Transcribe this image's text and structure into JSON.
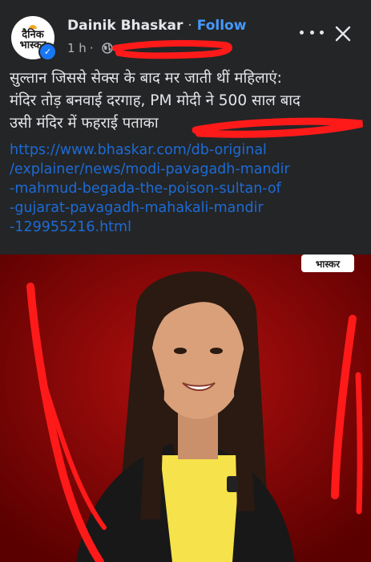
{
  "post": {
    "page_name": "Dainik Bhaskar",
    "separator": "·",
    "follow_label": "Follow",
    "time": "1 h",
    "time_separator": "·",
    "avatar_logo_line1": "दैनिक",
    "avatar_logo_line2": "भास्कर",
    "privacy_icon": "globe-icon",
    "more_icon": "more-horizontal-icon",
    "close_icon": "close-icon",
    "text_lines": [
      "सुल्तान जिससे सेक्स के बाद मर जाती थीं महिलाएं:",
      "मंदिर तोड़ बनवाई दरगाह, PM मोदी ने 500 साल बाद",
      "उसी मंदिर में फहराई पताका"
    ],
    "link_lines": [
      "https://www.bhaskar.com/db-original",
      "/explainer/news/modi-pavagadh-mandir",
      "-mahmud-begada-the-poison-sultan-of",
      "-gujarat-pavagadh-mahakali-mandir",
      "-129955216.html"
    ]
  },
  "media": {
    "watermark": "भास्कर"
  },
  "colors": {
    "background": "#242526",
    "text": "#e4e6eb",
    "link": "#1d6bd6",
    "follow": "#4599ff",
    "scribble": "#ff1a1a",
    "media_bg": "#7a0000"
  }
}
